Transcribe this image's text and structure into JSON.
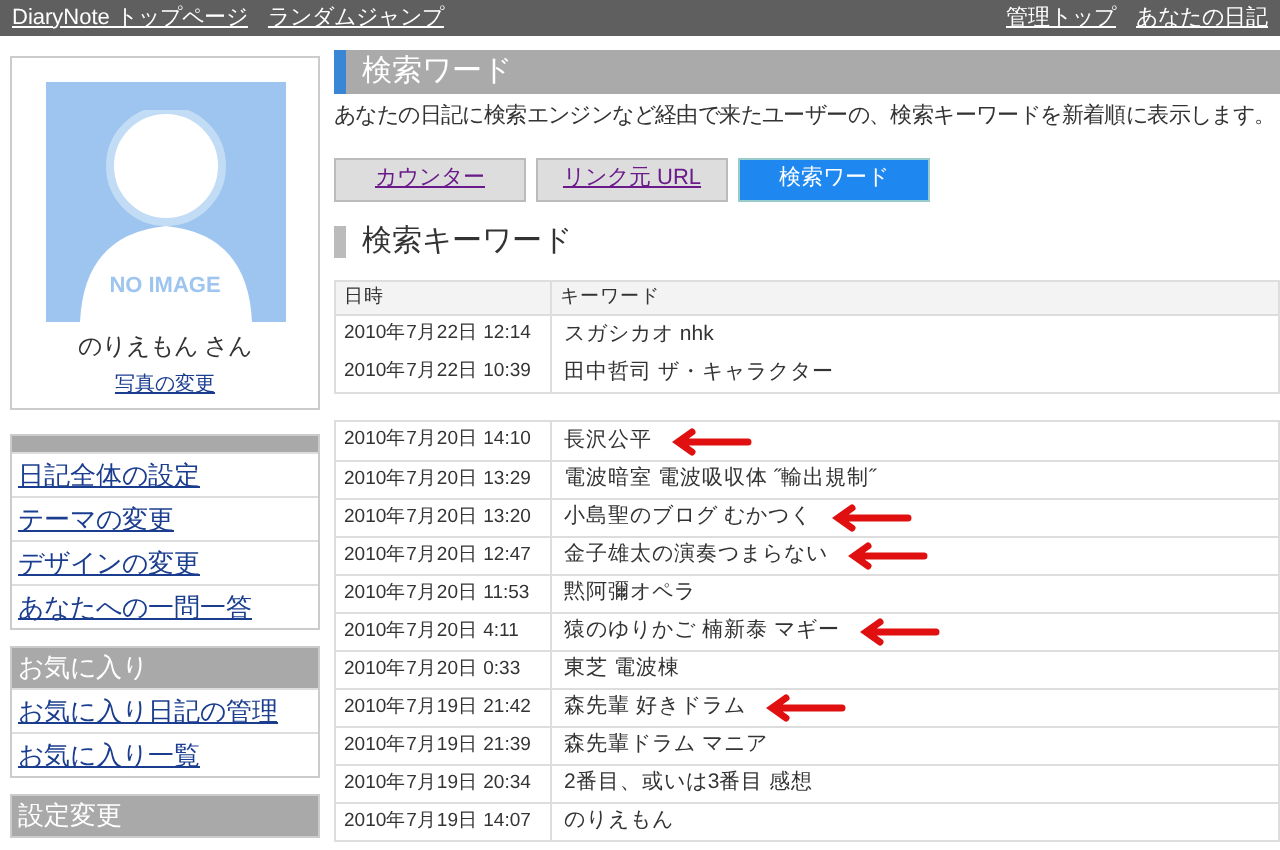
{
  "top_bar": {
    "left_links": [
      "DiaryNote トップページ",
      "ランダムジャンプ"
    ],
    "right_links": [
      "管理トップ",
      "あなたの日記"
    ]
  },
  "profile": {
    "avatar_text": "NO IMAGE",
    "name": "のりえもん さん",
    "photo_link": "写真の変更"
  },
  "sidebar": {
    "sections": [
      {
        "items": [
          "日記全体の設定",
          "テーマの変更",
          "デザインの変更",
          "あなたへの一問一答"
        ]
      },
      {
        "heading": "お気に入り",
        "items": [
          "お気に入り日記の管理",
          "お気に入り一覧"
        ]
      },
      {
        "heading": "設定変更"
      }
    ]
  },
  "main": {
    "title": "検索ワード",
    "description": "あなたの日記に検索エンジンなど経由で来たユーザーの、検索キーワードを新着順に表示します。",
    "tabs": [
      {
        "label": "カウンター",
        "selected": false
      },
      {
        "label": "リンク元 URL",
        "selected": false
      },
      {
        "label": "検索ワード",
        "selected": true
      }
    ],
    "section_title": "検索キーワード",
    "table": {
      "columns": [
        "日時",
        "キーワード"
      ],
      "groups": [
        [
          {
            "date": "2010年7月22日 12:14",
            "keyword": "スガシカオ nhk",
            "annotated": false
          },
          {
            "date": "2010年7月22日 10:39",
            "keyword": "田中哲司 ザ・キャラクター",
            "annotated": false
          }
        ],
        [
          {
            "date": "2010年7月20日 14:10",
            "keyword": "長沢公平",
            "annotated": true
          },
          {
            "date": "2010年7月20日 13:29",
            "keyword": "電波暗室 電波吸収体 ˝輸出規制˝",
            "annotated": false
          },
          {
            "date": "2010年7月20日 13:20",
            "keyword": "小島聖のブログ むかつく",
            "annotated": true
          },
          {
            "date": "2010年7月20日 12:47",
            "keyword": "金子雄太の演奏つまらない",
            "annotated": true
          },
          {
            "date": "2010年7月20日 11:53",
            "keyword": "黙阿彌オペラ",
            "annotated": false
          },
          {
            "date": "2010年7月20日 4:11",
            "keyword": "猿のゆりかご 楠新泰 マギー",
            "annotated": true
          },
          {
            "date": "2010年7月20日 0:33",
            "keyword": "東芝 電波棟",
            "annotated": false
          },
          {
            "date": "2010年7月19日 21:42",
            "keyword": "森先輩 好きドラム",
            "annotated": true
          },
          {
            "date": "2010年7月19日 21:39",
            "keyword": "森先輩ドラム マニア",
            "annotated": false
          },
          {
            "date": "2010年7月19日 20:34",
            "keyword": "2番目、或いは3番目 感想",
            "annotated": false
          },
          {
            "date": "2010年7月19日 14:07",
            "keyword": "のりえもん",
            "annotated": false
          }
        ]
      ]
    }
  }
}
